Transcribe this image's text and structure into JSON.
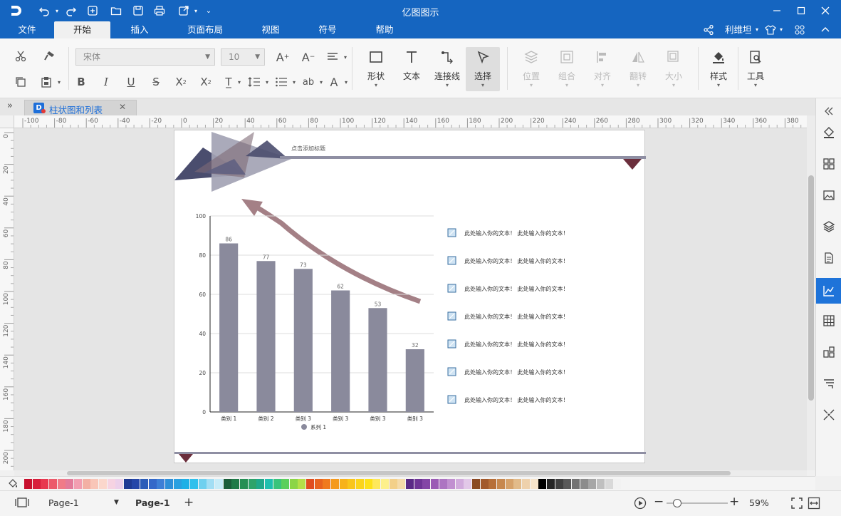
{
  "app": {
    "title": "亿图图示"
  },
  "titlebar_icons": [
    "app-logo-icon",
    "undo-icon",
    "redo-icon",
    "new-icon",
    "open-icon",
    "save-icon",
    "print-icon",
    "export-icon",
    "customize-icon"
  ],
  "menu": {
    "items": [
      {
        "label": "文件"
      },
      {
        "label": "开始",
        "active": true
      },
      {
        "label": "插入"
      },
      {
        "label": "页面布局"
      },
      {
        "label": "视图"
      },
      {
        "label": "符号"
      },
      {
        "label": "帮助"
      }
    ],
    "user": "利维坦"
  },
  "ribbon": {
    "font_name": "宋体",
    "font_size": "10",
    "big_buttons": [
      {
        "label": "形状",
        "enabled": true
      },
      {
        "label": "文本",
        "enabled": true
      },
      {
        "label": "连接线",
        "enabled": true
      },
      {
        "label": "选择",
        "enabled": true,
        "selected": true
      },
      {
        "label": "位置",
        "enabled": false
      },
      {
        "label": "组合",
        "enabled": false
      },
      {
        "label": "对齐",
        "enabled": false
      },
      {
        "label": "翻转",
        "enabled": false
      },
      {
        "label": "大小",
        "enabled": false
      },
      {
        "label": "样式",
        "enabled": true
      },
      {
        "label": "工具",
        "enabled": true
      }
    ]
  },
  "document_tab": {
    "label": "柱状图和列表"
  },
  "ruler": {
    "h_labels": [
      "-100",
      "-80",
      "-60",
      "-40",
      "-20",
      "0",
      "20",
      "40",
      "60",
      "80",
      "100",
      "120",
      "140",
      "160",
      "180",
      "200",
      "220",
      "240",
      "260",
      "280",
      "300",
      "320",
      "340",
      "360",
      "380"
    ],
    "v_labels": [
      "0",
      "20",
      "40",
      "60",
      "80",
      "100",
      "120",
      "140",
      "160",
      "180",
      "200"
    ]
  },
  "slide": {
    "title_placeholder": "点击添加标题",
    "list_text": "此处输入你的文本！ 此处输入你的文本！",
    "list_count": 7
  },
  "chart_data": {
    "type": "bar",
    "categories": [
      "类别 1",
      "类别 2",
      "类别 3",
      "类别 3",
      "类别 3",
      "类别 3"
    ],
    "series": [
      {
        "name": "系列 1",
        "values": [
          86,
          77,
          73,
          62,
          53,
          32
        ]
      }
    ],
    "ylim": [
      0,
      100
    ],
    "yticks": [
      0,
      20,
      40,
      60,
      80,
      100
    ],
    "bar_color": "#8a8a9c",
    "grid": true,
    "legend": "bottom"
  },
  "colors": {
    "brand": "#1565c0",
    "accent": "#1e73d9",
    "palette": [
      "#c8102e",
      "#d81e3c",
      "#e8374f",
      "#ec5a6b",
      "#f07b88",
      "#e37b9a",
      "#f29eb1",
      "#f3b0a4",
      "#f9c6b8",
      "#fbd7cc",
      "#f6d3e2",
      "#ecd0ea",
      "#1f3a93",
      "#2546a8",
      "#2b5cb8",
      "#3468c9",
      "#3e7fd6",
      "#2f8fd8",
      "#2aa0e0",
      "#1eb0e6",
      "#2fc0ec",
      "#6fd0ef",
      "#a2def4",
      "#c7ecf8",
      "#1a5e3a",
      "#1f7a47",
      "#258f54",
      "#2ea36a",
      "#20a88a",
      "#1fbfae",
      "#39c47b",
      "#5bcf5b",
      "#8bd546",
      "#b5df48",
      "#e04d1f",
      "#e8631f",
      "#f07a1e",
      "#f59a1c",
      "#f7b21a",
      "#f9c51b",
      "#fbd41a",
      "#fde119",
      "#fee85a",
      "#fdf08b",
      "#f3d089",
      "#f5dbaa",
      "#5b2a86",
      "#6f3596",
      "#8446a6",
      "#9b5bb5",
      "#ad74c2",
      "#c190d0",
      "#d1abdc",
      "#e2c8e8",
      "#8b4a24",
      "#a25a2c",
      "#b76f39",
      "#c7884f",
      "#d6a26b",
      "#e2bb8a",
      "#eed1ac",
      "#f6e4cb",
      "#000000",
      "#262626",
      "#404040",
      "#595959",
      "#737373",
      "#8c8c8c",
      "#a6a6a6",
      "#bfbfbf",
      "#d9d9d9",
      "#f2f2f2"
    ]
  },
  "status": {
    "page_selector": "Page-1",
    "page_tab": "Page-1",
    "zoom": "59%"
  }
}
